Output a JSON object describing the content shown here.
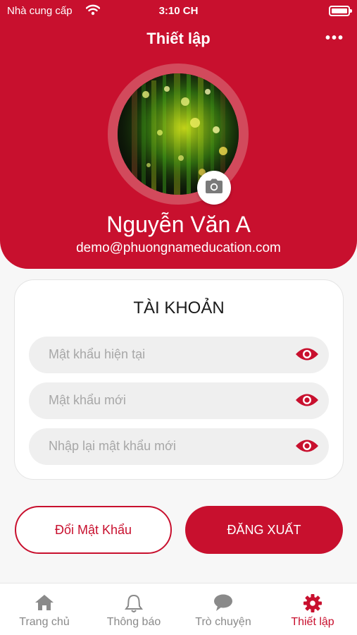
{
  "status_bar": {
    "carrier": "Nhà cung cấp",
    "time": "3:10 CH"
  },
  "header": {
    "title": "Thiết lập",
    "more_label": "•••"
  },
  "profile": {
    "name": "Nguyễn Văn A",
    "email": "demo@phuongnameducation.com"
  },
  "account": {
    "title": "TÀI KHOẢN",
    "fields": [
      {
        "placeholder": "Mật khẩu hiện tại"
      },
      {
        "placeholder": "Mật khẩu mới"
      },
      {
        "placeholder": "Nhập lại mật khẩu mới"
      }
    ]
  },
  "actions": {
    "change_password": "Đổi Mật Khẩu",
    "logout": "ĐĂNG XUẤT"
  },
  "tabs": [
    {
      "label": "Trang chủ",
      "icon": "home-icon"
    },
    {
      "label": "Thông báo",
      "icon": "bell-icon"
    },
    {
      "label": "Trò chuyện",
      "icon": "chat-icon"
    },
    {
      "label": "Thiết lập",
      "icon": "gear-icon",
      "active": true
    }
  ],
  "colors": {
    "brand": "#c8102e",
    "inactive": "#8a8a8a"
  }
}
